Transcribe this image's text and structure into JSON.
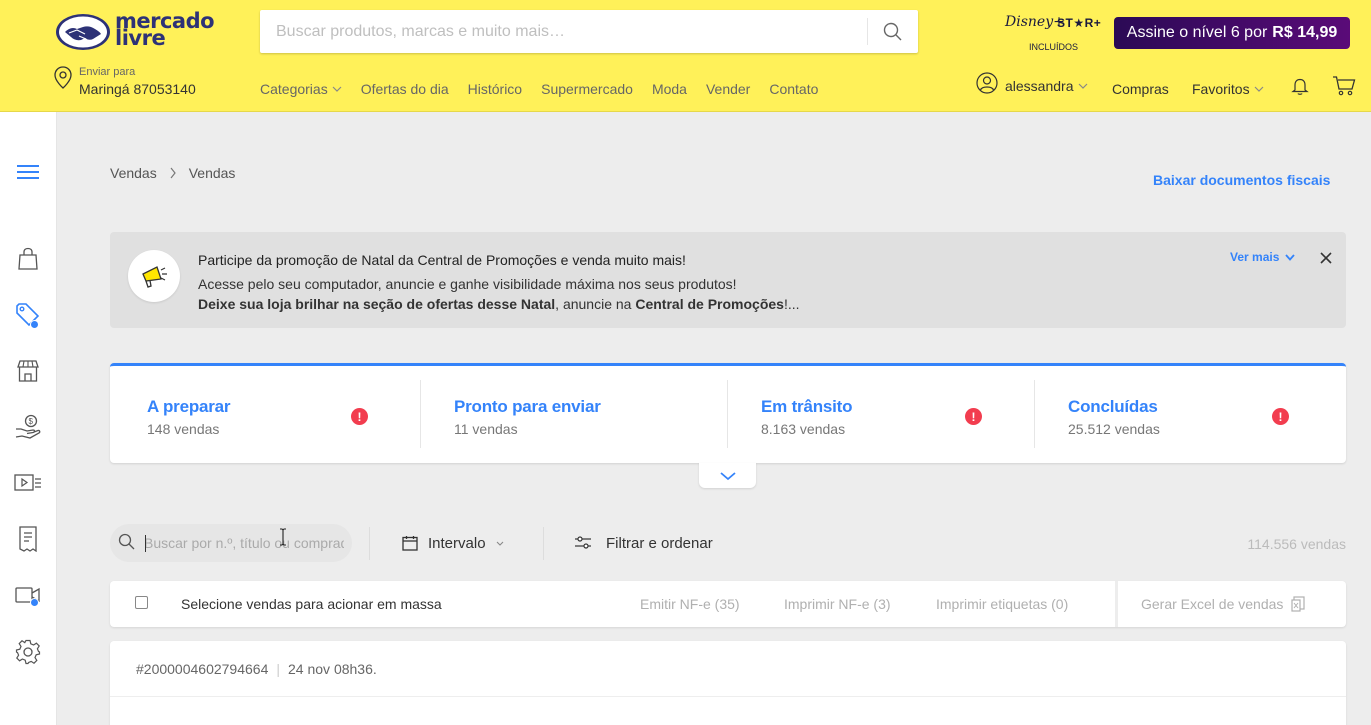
{
  "header": {
    "logo_text": "mercado livre",
    "logo_line1": "mercado",
    "logo_line2": "livre",
    "search_placeholder": "Buscar produtos, marcas e muito mais…",
    "disney_text": "Disney+",
    "star_text": "ST★R+",
    "included_text": "INCLUÍDOS",
    "subscribe_text": "Assine o nível 6 por",
    "subscribe_price": "R$ 14,99",
    "location_label": "Enviar para",
    "location_value": "Maringá 87053140",
    "nav": [
      "Categorias",
      "Ofertas do dia",
      "Histórico",
      "Supermercado",
      "Moda",
      "Vender",
      "Contato"
    ],
    "user": "alessandra",
    "compras": "Compras",
    "favoritos": "Favoritos"
  },
  "breadcrumb": [
    "Vendas",
    "Vendas"
  ],
  "baixar": "Baixar documentos fiscais",
  "promo": {
    "title": "Participe da promoção de Natal da Central de Promoções e venda muito mais!",
    "line2": "Acesse pelo seu computador, anuncie e ganhe visibilidade máxima nos seus produtos!",
    "line3_bold1": "Deixe sua loja brilhar na seção de ofertas desse Natal",
    "line3_mid": ", anuncie na ",
    "line3_bold2": "Central de Promoções",
    "line3_end": "!...",
    "ver_mais": "Ver mais"
  },
  "status": [
    {
      "title": "A preparar",
      "count": "148 vendas",
      "alert": true
    },
    {
      "title": "Pronto para enviar",
      "count": "11 vendas",
      "alert": false
    },
    {
      "title": "Em trânsito",
      "count": "8.163 vendas",
      "alert": true
    },
    {
      "title": "Concluídas",
      "count": "25.512 vendas",
      "alert": true
    }
  ],
  "filters": {
    "search_placeholder": "Buscar por n.º, título ou comprador",
    "interval": "Intervalo",
    "filter_sort": "Filtrar e ordenar",
    "total": "114.556 vendas"
  },
  "bulk": {
    "label": "Selecione vendas para acionar em massa",
    "emitir": "Emitir NF-e (35)",
    "imprimir_nfe": "Imprimir NF-e (3)",
    "imprimir_etiquetas": "Imprimir etiquetas (0)",
    "excel": "Gerar Excel de vendas"
  },
  "order": {
    "id": "#2000004602794664",
    "separator": "|",
    "date": "24 nov 08h36."
  },
  "colors": {
    "header_bg": "#fff159",
    "accent": "#3483fa",
    "alert": "#f23d4f"
  }
}
